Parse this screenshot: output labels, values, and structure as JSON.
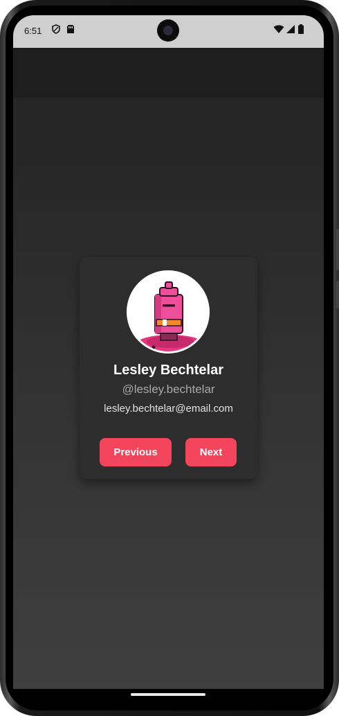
{
  "status_bar": {
    "time": "6:51",
    "icons": [
      "shield-icon",
      "sim-card-icon",
      "wifi-icon",
      "signal-icon",
      "battery-icon"
    ]
  },
  "profile": {
    "name": "Lesley Bechtelar",
    "username": "@lesley.bechtelar",
    "email": "lesley.bechtelar@email.com",
    "avatar_icon": "robot-avatar-icon"
  },
  "actions": {
    "previous_label": "Previous",
    "next_label": "Next"
  },
  "colors": {
    "accent": "#f2455c",
    "card_background": "#2d2d2d",
    "screen_background": "#1f1f1f"
  }
}
